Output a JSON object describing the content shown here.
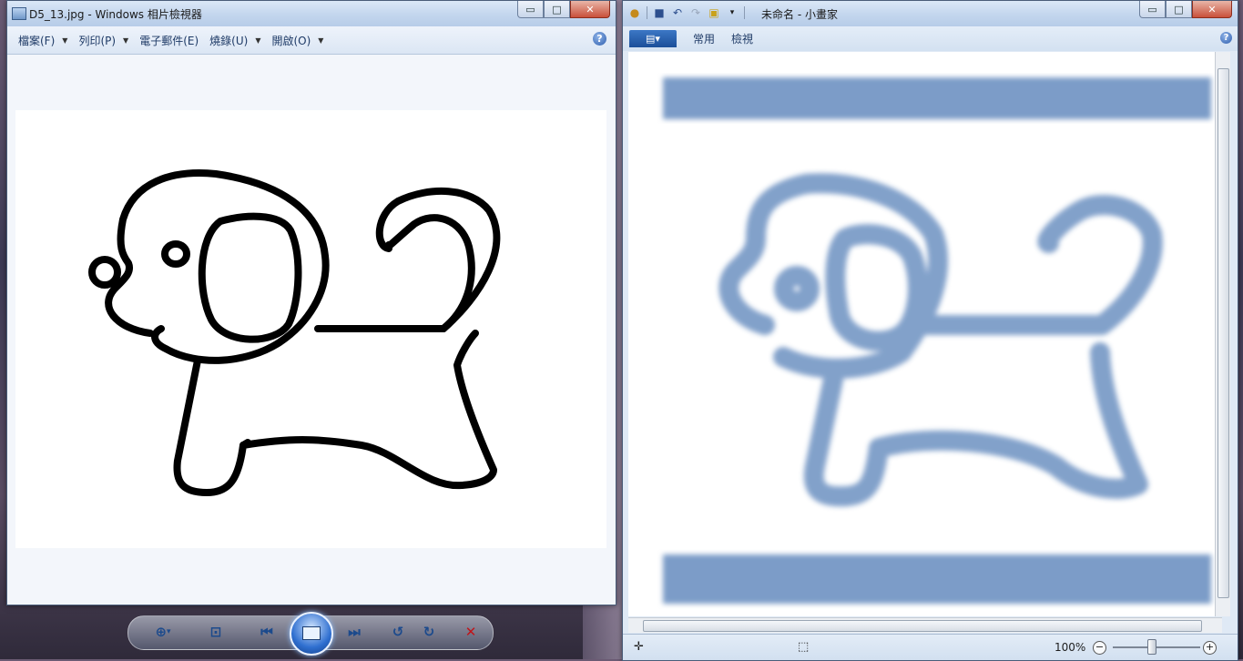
{
  "viewer": {
    "title": "D5_13.jpg - Windows 相片檢視器",
    "menu": [
      {
        "label": "檔案(F)",
        "has_arrow": true
      },
      {
        "label": "列印(P)",
        "has_arrow": true
      },
      {
        "label": "電子郵件(E)",
        "has_arrow": false
      },
      {
        "label": "燒錄(U)",
        "has_arrow": true
      },
      {
        "label": "開啟(O)",
        "has_arrow": true
      }
    ],
    "help": "?",
    "toolbar_icons": [
      "zoom-icon",
      "fit-window-icon",
      "previous-icon",
      "slideshow-icon",
      "next-icon",
      "rotate-left-icon",
      "rotate-right-icon",
      "delete-icon"
    ]
  },
  "paint": {
    "title": "未命名 - 小畫家",
    "file_tab": "▤▾",
    "tabs": [
      "常用",
      "檢視"
    ],
    "help": "?",
    "zoom_label": "100%",
    "zoom_minus": "−",
    "zoom_plus": "+"
  },
  "window_buttons": {
    "minimize": "▭",
    "maximize": "□",
    "close": "✕"
  },
  "colors": {
    "outline": "#000000",
    "paint_blue": "#7b9cc8"
  }
}
